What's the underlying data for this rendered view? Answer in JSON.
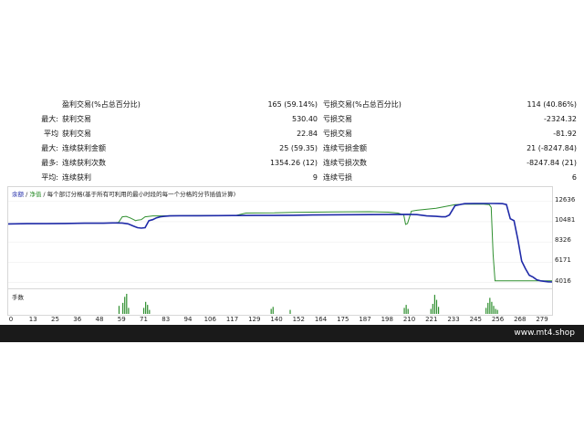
{
  "stats": {
    "rows": [
      {
        "p1": "",
        "l1": "盈利交易(%占总百分比)",
        "v1": "165 (59.14%)",
        "l2": "亏损交易(%占总百分比)",
        "v2": "114 (40.86%)"
      },
      {
        "p1": "最大:",
        "l1": "获利交易",
        "v1": "530.40",
        "l2": "亏损交易",
        "v2": "-2324.32"
      },
      {
        "p1": "平均",
        "l1": "获利交易",
        "v1": "22.84",
        "l2": "亏损交易",
        "v2": "-81.92"
      },
      {
        "p1": "最大:",
        "l1": "连续获利金额",
        "v1": "25 (59.35)",
        "l2": "连续亏损金额",
        "v2": "21 (-8247.84)"
      },
      {
        "p1": "最多:",
        "l1": "连续获利次数",
        "v1": "1354.26 (12)",
        "l2": "连续亏损次数",
        "v2": "-8247.84 (21)"
      },
      {
        "p1": "平均:",
        "l1": "连续获利",
        "v1": "9",
        "l2": "连续亏损",
        "v2": "6"
      }
    ]
  },
  "legend": {
    "balance": "余额",
    "sep": " / ",
    "equity": "净值",
    "desc": " / 每个部订分格(基于所有可利用的最小时段的每一个分格的分节插值计算)"
  },
  "lots_label": "手数",
  "footer_text": "www.mt4.shop",
  "colors": {
    "balance": "#1f2aa8",
    "equity": "#2f8f2f",
    "lots": "#2f8f2f"
  },
  "chart_data": {
    "type": "line",
    "x_ticks": [
      "0",
      "13",
      "25",
      "36",
      "48",
      "59",
      "71",
      "83",
      "94",
      "106",
      "117",
      "129",
      "140",
      "152",
      "164",
      "175",
      "187",
      "198",
      "210",
      "221",
      "233",
      "245",
      "256",
      "268",
      "279"
    ],
    "y_ticks": [
      "12636",
      "10481",
      "8326",
      "6171",
      "4016"
    ],
    "ylim": [
      3500,
      13000
    ],
    "xlim": [
      0,
      286
    ],
    "series": [
      {
        "name": "余额",
        "x": [
          0,
          10,
          20,
          30,
          40,
          50,
          55,
          60,
          63,
          66,
          68,
          70,
          72,
          74,
          76,
          78,
          80,
          82,
          85,
          90,
          100,
          110,
          120,
          130,
          140,
          150,
          160,
          170,
          180,
          190,
          200,
          210,
          215,
          220,
          225,
          228,
          230,
          232,
          235,
          240,
          245,
          250,
          255,
          258,
          260,
          262,
          264,
          266,
          268,
          270,
          272,
          274,
          276,
          278,
          280,
          284,
          286
        ],
        "y": [
          10250,
          10280,
          10280,
          10300,
          10320,
          10320,
          10350,
          10340,
          10260,
          10000,
          9850,
          9800,
          9850,
          10600,
          10700,
          10900,
          11000,
          11050,
          11100,
          11120,
          11120,
          11130,
          11140,
          11150,
          11150,
          11170,
          11200,
          11220,
          11230,
          11240,
          11250,
          11260,
          11240,
          11100,
          11050,
          11000,
          11000,
          11200,
          12200,
          12400,
          12420,
          12420,
          12420,
          12410,
          12400,
          12300,
          10800,
          10600,
          8600,
          6300,
          5500,
          4800,
          4600,
          4300,
          4200,
          4100,
          4080
        ]
      },
      {
        "name": "净值",
        "x": [
          0,
          10,
          20,
          30,
          40,
          50,
          55,
          58,
          60,
          62,
          64,
          66,
          67,
          68,
          70,
          72,
          74,
          76,
          78,
          80,
          85,
          90,
          100,
          110,
          120,
          125,
          130,
          140,
          150,
          160,
          170,
          180,
          190,
          200,
          205,
          208,
          209,
          210,
          212,
          215,
          225,
          235,
          240,
          250,
          253,
          254,
          255,
          256,
          258,
          260,
          270,
          280,
          286
        ],
        "y": [
          10250,
          10280,
          10290,
          10300,
          10320,
          10320,
          10360,
          10400,
          11000,
          11050,
          10900,
          10700,
          10600,
          10650,
          10700,
          11000,
          11050,
          11100,
          11100,
          11100,
          11120,
          11120,
          11130,
          11150,
          11160,
          11400,
          11410,
          11420,
          11480,
          11500,
          11520,
          11540,
          11550,
          11500,
          11400,
          11200,
          10200,
          10300,
          11600,
          11700,
          11900,
          12300,
          12350,
          12350,
          12300,
          12000,
          7000,
          4200,
          4200,
          4200,
          4200,
          4200,
          4200
        ]
      }
    ],
    "lots": [
      {
        "x": 58,
        "v": 0.4
      },
      {
        "x": 60,
        "v": 0.55
      },
      {
        "x": 61,
        "v": 0.85
      },
      {
        "x": 62,
        "v": 1.0
      },
      {
        "x": 63,
        "v": 0.3
      },
      {
        "x": 71,
        "v": 0.3
      },
      {
        "x": 72,
        "v": 0.6
      },
      {
        "x": 73,
        "v": 0.45
      },
      {
        "x": 74,
        "v": 0.2
      },
      {
        "x": 138,
        "v": 0.25
      },
      {
        "x": 139,
        "v": 0.35
      },
      {
        "x": 148,
        "v": 0.2
      },
      {
        "x": 208,
        "v": 0.3
      },
      {
        "x": 209,
        "v": 0.45
      },
      {
        "x": 210,
        "v": 0.25
      },
      {
        "x": 222,
        "v": 0.25
      },
      {
        "x": 223,
        "v": 0.5
      },
      {
        "x": 224,
        "v": 0.95
      },
      {
        "x": 225,
        "v": 0.7
      },
      {
        "x": 226,
        "v": 0.35
      },
      {
        "x": 251,
        "v": 0.3
      },
      {
        "x": 252,
        "v": 0.55
      },
      {
        "x": 253,
        "v": 0.8
      },
      {
        "x": 254,
        "v": 0.6
      },
      {
        "x": 255,
        "v": 0.4
      },
      {
        "x": 256,
        "v": 0.25
      },
      {
        "x": 257,
        "v": 0.2
      }
    ]
  }
}
